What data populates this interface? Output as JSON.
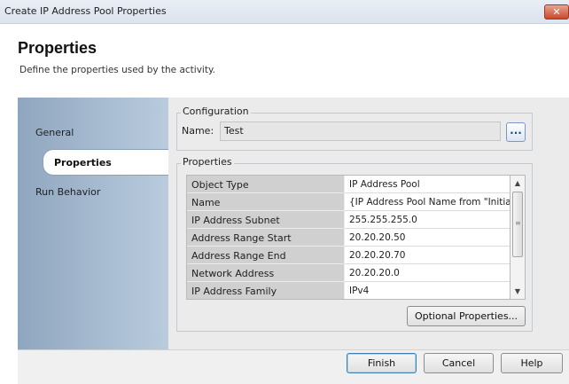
{
  "window": {
    "title": "Create IP Address Pool Properties",
    "close_symbol": "✕"
  },
  "header": {
    "title": "Properties",
    "subtitle": "Define the properties used by the activity."
  },
  "nav": {
    "items": [
      {
        "label": "General",
        "selected": false
      },
      {
        "label": "Properties",
        "selected": true
      },
      {
        "label": "Run Behavior",
        "selected": false
      }
    ]
  },
  "configuration": {
    "group_label": "Configuration",
    "name_label": "Name:",
    "name_value": "Test",
    "browse_label": "..."
  },
  "properties": {
    "group_label": "Properties",
    "rows": [
      {
        "name": "Object Type",
        "value": "IP Address Pool"
      },
      {
        "name": "Name",
        "value": "{IP Address Pool Name from \"Initializ"
      },
      {
        "name": "IP Address Subnet",
        "value": "255.255.255.0"
      },
      {
        "name": "Address Range Start",
        "value": "20.20.20.50"
      },
      {
        "name": "Address Range End",
        "value": "20.20.20.70"
      },
      {
        "name": "Network Address",
        "value": "20.20.20.0"
      },
      {
        "name": "IP Address Family",
        "value": "IPv4"
      }
    ],
    "optional_button": "Optional Properties..."
  },
  "footer": {
    "finish": "Finish",
    "cancel": "Cancel",
    "help": "Help"
  },
  "icons": {
    "scroll_up": "▲",
    "scroll_down": "▼",
    "grip": "≡"
  }
}
